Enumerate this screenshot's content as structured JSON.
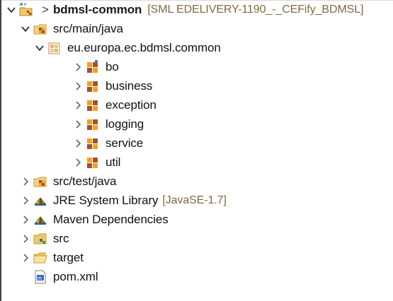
{
  "tree": {
    "project": {
      "separator": ">",
      "name": "bdmsl-common",
      "decoration": "[SML EDELIVERY-1190_-_CEFify_BDMSL]"
    },
    "src_main": {
      "label": "src/main/java"
    },
    "package": {
      "label": "eu.europa.ec.bdmsl.common"
    },
    "subpackages": [
      {
        "label": "bo"
      },
      {
        "label": "business"
      },
      {
        "label": "exception"
      },
      {
        "label": "logging"
      },
      {
        "label": "service"
      },
      {
        "label": "util"
      }
    ],
    "src_test": {
      "label": "src/test/java"
    },
    "jre": {
      "label": "JRE System Library",
      "decoration": "[JavaSE-1.7]"
    },
    "maven": {
      "label": "Maven Dependencies"
    },
    "src_folder": {
      "label": "src"
    },
    "target_folder": {
      "label": "target"
    },
    "pom": {
      "label": "pom.xml"
    }
  },
  "colors": {
    "decoration": "#7e6a45",
    "package_brown": "#a0522d",
    "package_gold": "#e8a33c"
  }
}
